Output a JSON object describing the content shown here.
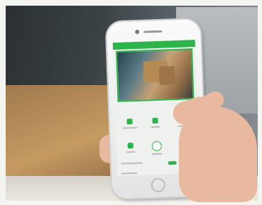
{
  "colors": {
    "accent": "#2cb34a"
  },
  "phone_screen": {
    "tiles": [
      {
        "name": "tile-1",
        "icon": "camera-icon"
      },
      {
        "name": "tile-2",
        "icon": "light-icon"
      },
      {
        "name": "tile-3",
        "icon": "lock-icon"
      },
      {
        "name": "tile-4",
        "icon": "alarm-icon"
      },
      {
        "name": "tile-5",
        "icon": "record-icon"
      },
      {
        "name": "tile-6",
        "icon": "delivery-icon"
      }
    ]
  }
}
